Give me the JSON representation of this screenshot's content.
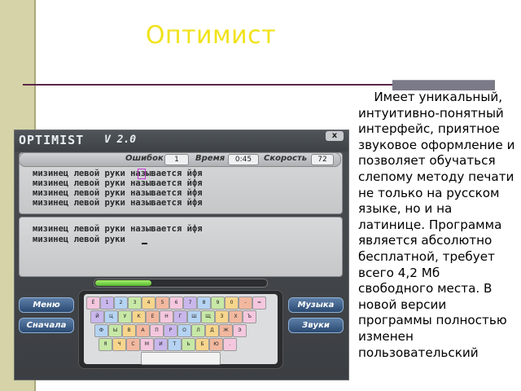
{
  "slide": {
    "title": "Оптимист",
    "body": "    Имеет уникальный, интуитивно-понятный интерфейс, приятное звуковое оформление и позволяет обучаться слепому методу печати не только на русском языке, но и на латинице. Программа является абсолютно бесплатной, требует всего 4,2 Мб свободного места. В новой версии программы полностью изменен пользовательский"
  },
  "app": {
    "logo": "OPTIMIST",
    "version": "V 2.0",
    "close_label": "x",
    "stats": {
      "errors_label": "Ошибок",
      "errors_value": "1",
      "time_label": "Время",
      "time_value": "0:45",
      "speed_label": "Скорость",
      "speed_value": "72"
    },
    "lesson_lines": [
      "мизинец левой руки называется йфя",
      "мизинец левой руки называется йфя",
      "мизинец левой руки называется йфя",
      "мизинец левой руки называется йфя"
    ],
    "typed_lines": [
      "мизинец левой руки называется йфя",
      "мизинец левой руки"
    ],
    "progress": 0.33,
    "buttons": {
      "menu": "Меню",
      "restart": "Сначала",
      "music": "Музыка",
      "sounds": "Звуки"
    },
    "keyboard_rows": [
      [
        "Ё",
        "1",
        "2",
        "3",
        "4",
        "5",
        "6",
        "7",
        "8",
        "9",
        "0",
        "-",
        "="
      ],
      [
        "Й",
        "Ц",
        "У",
        "К",
        "Е",
        "Н",
        "Г",
        "Ш",
        "Щ",
        "З",
        "Х",
        "Ъ"
      ],
      [
        "Ф",
        "Ы",
        "В",
        "А",
        "П",
        "Р",
        "О",
        "Л",
        "Д",
        "Ж",
        "Э"
      ],
      [
        "Я",
        "Ч",
        "С",
        "М",
        "И",
        "Т",
        "Ь",
        "Б",
        "Ю",
        "."
      ]
    ]
  }
}
